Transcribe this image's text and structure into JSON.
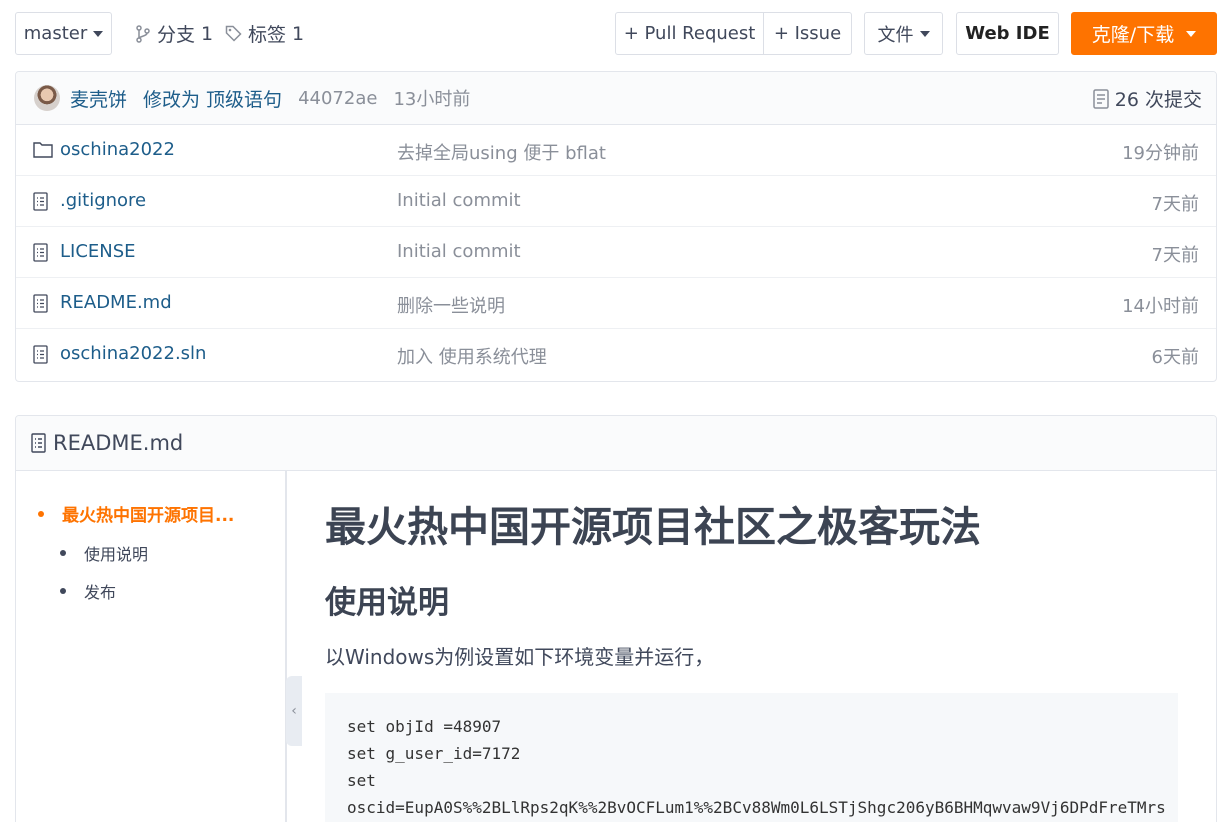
{
  "toolbar": {
    "branch": "master",
    "branches_label": "分支",
    "branches_count": "1",
    "tags_label": "标签",
    "tags_count": "1",
    "pull_request": "+ Pull Request",
    "issue": "+ Issue",
    "file": "文件",
    "web_ide": "Web IDE",
    "clone": "克隆/下载",
    "clone_color": "#fe7300"
  },
  "commit": {
    "author": "麦壳饼",
    "message": "修改为 顶级语句",
    "sha": "44072ae",
    "time": "13小时前",
    "count_label": "26 次提交"
  },
  "files": [
    {
      "icon": "folder-icon",
      "name": "oschina2022",
      "message": "去掉全局using 便于 bflat",
      "time": "19分钟前"
    },
    {
      "icon": "file-icon",
      "name": ".gitignore",
      "message": "Initial commit",
      "time": "7天前"
    },
    {
      "icon": "file-icon",
      "name": "LICENSE",
      "message": "Initial commit",
      "time": "7天前"
    },
    {
      "icon": "file-icon",
      "name": "README.md",
      "message": "删除一些说明",
      "time": "14小时前"
    },
    {
      "icon": "file-icon",
      "name": "oschina2022.sln",
      "message": "加入 使用系统代理",
      "time": "6天前"
    }
  ],
  "readme": {
    "title": "README.md",
    "toc": {
      "active": "最火热中国开源项目...",
      "items": [
        "使用说明",
        "发布"
      ]
    },
    "h1": "最火热中国开源项目社区之极客玩法",
    "h2": "使用说明",
    "paragraph": "以Windows为例设置如下环境变量并运行，",
    "code": [
      "set objId =48907",
      "set g_user_id=7172",
      "set",
      "oscid=EupA0S%%2BLlRps2qK%%2BvOCFLum1%%2BCv88Wm0L6LSTjShgc206yB6BHMqwvaw9Vj6DPdFreTMrs"
    ]
  }
}
